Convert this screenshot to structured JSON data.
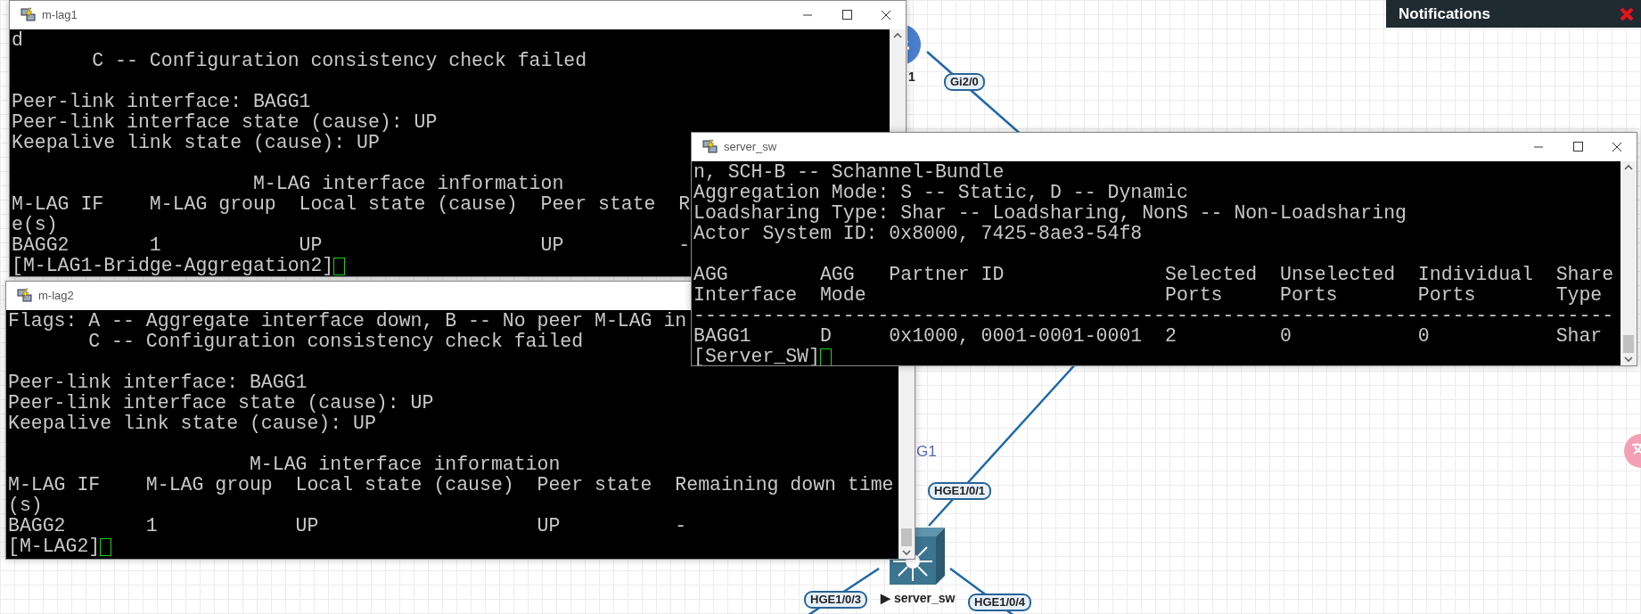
{
  "canvas": {
    "nodes": [
      {
        "kind": "router",
        "label": "1"
      },
      {
        "kind": "switch",
        "label": "server_sw",
        "marker": "▶"
      }
    ],
    "port_labels": [
      {
        "kind": "tag",
        "text": "Gi2/0"
      },
      {
        "kind": "plain",
        "text": "G1"
      },
      {
        "kind": "tag",
        "text": "HGE1/0/1"
      },
      {
        "kind": "tag",
        "text": "HGE1/0/3"
      },
      {
        "kind": "tag",
        "text": "HGE1/0/4"
      }
    ]
  },
  "windows": [
    {
      "title": "m-lag1",
      "lines": [
        {
          "kind": "text",
          "text": "d"
        },
        {
          "kind": "text",
          "text": "       C -- Configuration consistency check failed"
        },
        {
          "kind": "blank"
        },
        {
          "kind": "text",
          "text": "Peer-link interface: BAGG1"
        },
        {
          "kind": "text",
          "text": "Peer-link interface state (cause): UP"
        },
        {
          "kind": "text",
          "text": "Keepalive link state (cause): UP"
        },
        {
          "kind": "blank"
        },
        {
          "kind": "text",
          "text": "                     M-LAG interface information"
        },
        {
          "kind": "text",
          "text": "M-LAG IF    M-LAG group  Local state (cause)  Peer state  R"
        },
        {
          "kind": "text",
          "text": "e(s)"
        },
        {
          "kind": "text",
          "text": "BAGG2       1            UP                   UP          -"
        }
      ],
      "prompt": "[M-LAG1-Bridge-Aggregation2]"
    },
    {
      "title": "m-lag2",
      "lines": [
        {
          "kind": "text",
          "text": "Flags: A -- Aggregate interface down, B -- No peer M-LAG in"
        },
        {
          "kind": "text",
          "text": "       C -- Configuration consistency check failed"
        },
        {
          "kind": "blank"
        },
        {
          "kind": "text",
          "text": "Peer-link interface: BAGG1"
        },
        {
          "kind": "text",
          "text": "Peer-link interface state (cause): UP"
        },
        {
          "kind": "text",
          "text": "Keepalive link state (cause): UP"
        },
        {
          "kind": "blank"
        },
        {
          "kind": "text",
          "text": "                     M-LAG interface information"
        },
        {
          "kind": "text",
          "text": "M-LAG IF    M-LAG group  Local state (cause)  Peer state  Remaining down time"
        },
        {
          "kind": "text",
          "text": "(s)"
        },
        {
          "kind": "text",
          "text": "BAGG2       1            UP                   UP          -"
        }
      ],
      "prompt": "[M-LAG2]"
    },
    {
      "title": "server_sw",
      "lines": [
        {
          "kind": "text",
          "text": "n, SCH-B -- Schannel-Bundle"
        },
        {
          "kind": "text",
          "text": "Aggregation Mode: S -- Static, D -- Dynamic"
        },
        {
          "kind": "text",
          "text": "Loadsharing Type: Shar -- Loadsharing, NonS -- Non-Loadsharing"
        },
        {
          "kind": "text",
          "text": "Actor System ID: 0x8000, 7425-8ae3-54f8"
        },
        {
          "kind": "blank"
        },
        {
          "kind": "text",
          "text": "AGG        AGG   Partner ID              Selected  Unselected  Individual  Share"
        },
        {
          "kind": "text",
          "text": "Interface  Mode                          Ports     Ports       Ports       Type"
        },
        {
          "kind": "text",
          "text": "--------------------------------------------------------------------------------"
        },
        {
          "kind": "text",
          "text": "BAGG1      D     0x1000, 0001-0001-0001  2         0           0           Shar"
        }
      ],
      "prompt": "[Server_SW]"
    }
  ],
  "notifications": {
    "title": "Notifications"
  }
}
